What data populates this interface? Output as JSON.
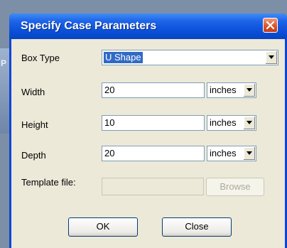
{
  "background": {
    "partial_text": "P"
  },
  "dialog": {
    "title": "Specify Case Parameters",
    "close_icon": "close-icon",
    "box_type": {
      "label": "Box Type",
      "value": "U Shape"
    },
    "width": {
      "label": "Width",
      "value": "20",
      "unit": "inches"
    },
    "height": {
      "label": "Height",
      "value": "10",
      "unit": "inches"
    },
    "depth": {
      "label": "Depth",
      "value": "20",
      "unit": "inches"
    },
    "template": {
      "label": "Template file:",
      "value": "",
      "browse_label": "Browse"
    },
    "ok_label": "OK",
    "close_label": "Close"
  },
  "colors": {
    "titlebar": "#0a4fd8",
    "client": "#ece9d8",
    "selection": "#316ac5",
    "close_button": "#d8502b"
  }
}
